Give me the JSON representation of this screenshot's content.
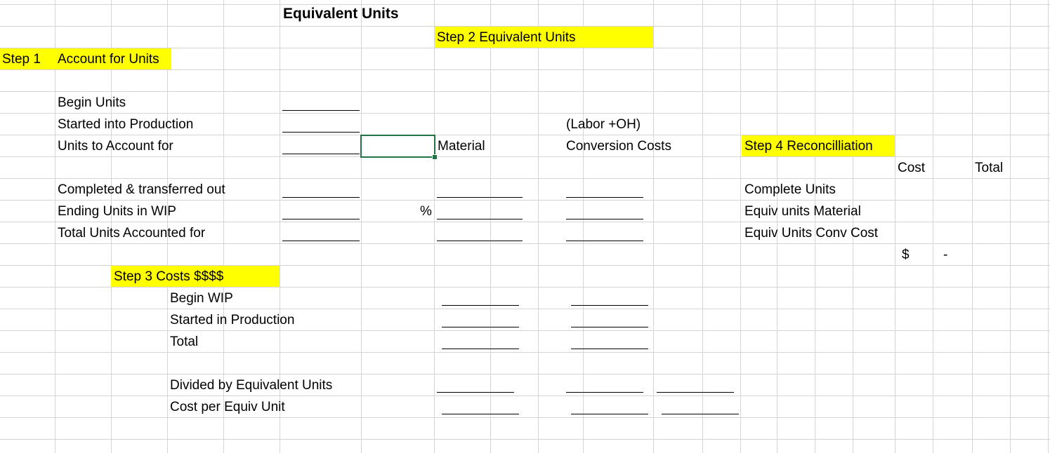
{
  "sheet": {
    "title": "Equivalent Units",
    "step2_label": "Step 2 Equivalent Units",
    "step1_label": "Step 1",
    "account_label": "Account for Units",
    "begin_units": "Begin Units",
    "started_into_production": "Started into Production",
    "units_to_account": "Units to Account for",
    "labor_oh": "(Labor +OH)",
    "material": "Material",
    "conversion_costs": "Conversion Costs",
    "step4_label": "Step 4 Reconcilliation",
    "cost_header": "Cost",
    "total_header": "Total",
    "completed_transferred": "Completed & transferred out",
    "ending_wip": "Ending Units in WIP",
    "percent_sign": "%",
    "total_accounted": "Total Units Accounted for",
    "complete_units": "Complete Units",
    "equiv_material": "Equiv units Material",
    "equiv_conv": "Equiv Units Conv Cost",
    "dollar_sign": "$",
    "dash": "-",
    "step3_label": "Step 3 Costs $$$$",
    "begin_wip": "Begin WIP",
    "started_in_production": "Started in Production",
    "total": "Total",
    "divided_by": "Divided by Equivalent Units",
    "cost_per_unit": "Cost per Equiv Unit"
  },
  "colors": {
    "highlight": "#ffff00",
    "gridline": "#d4d4d4",
    "selection": "#217346"
  }
}
